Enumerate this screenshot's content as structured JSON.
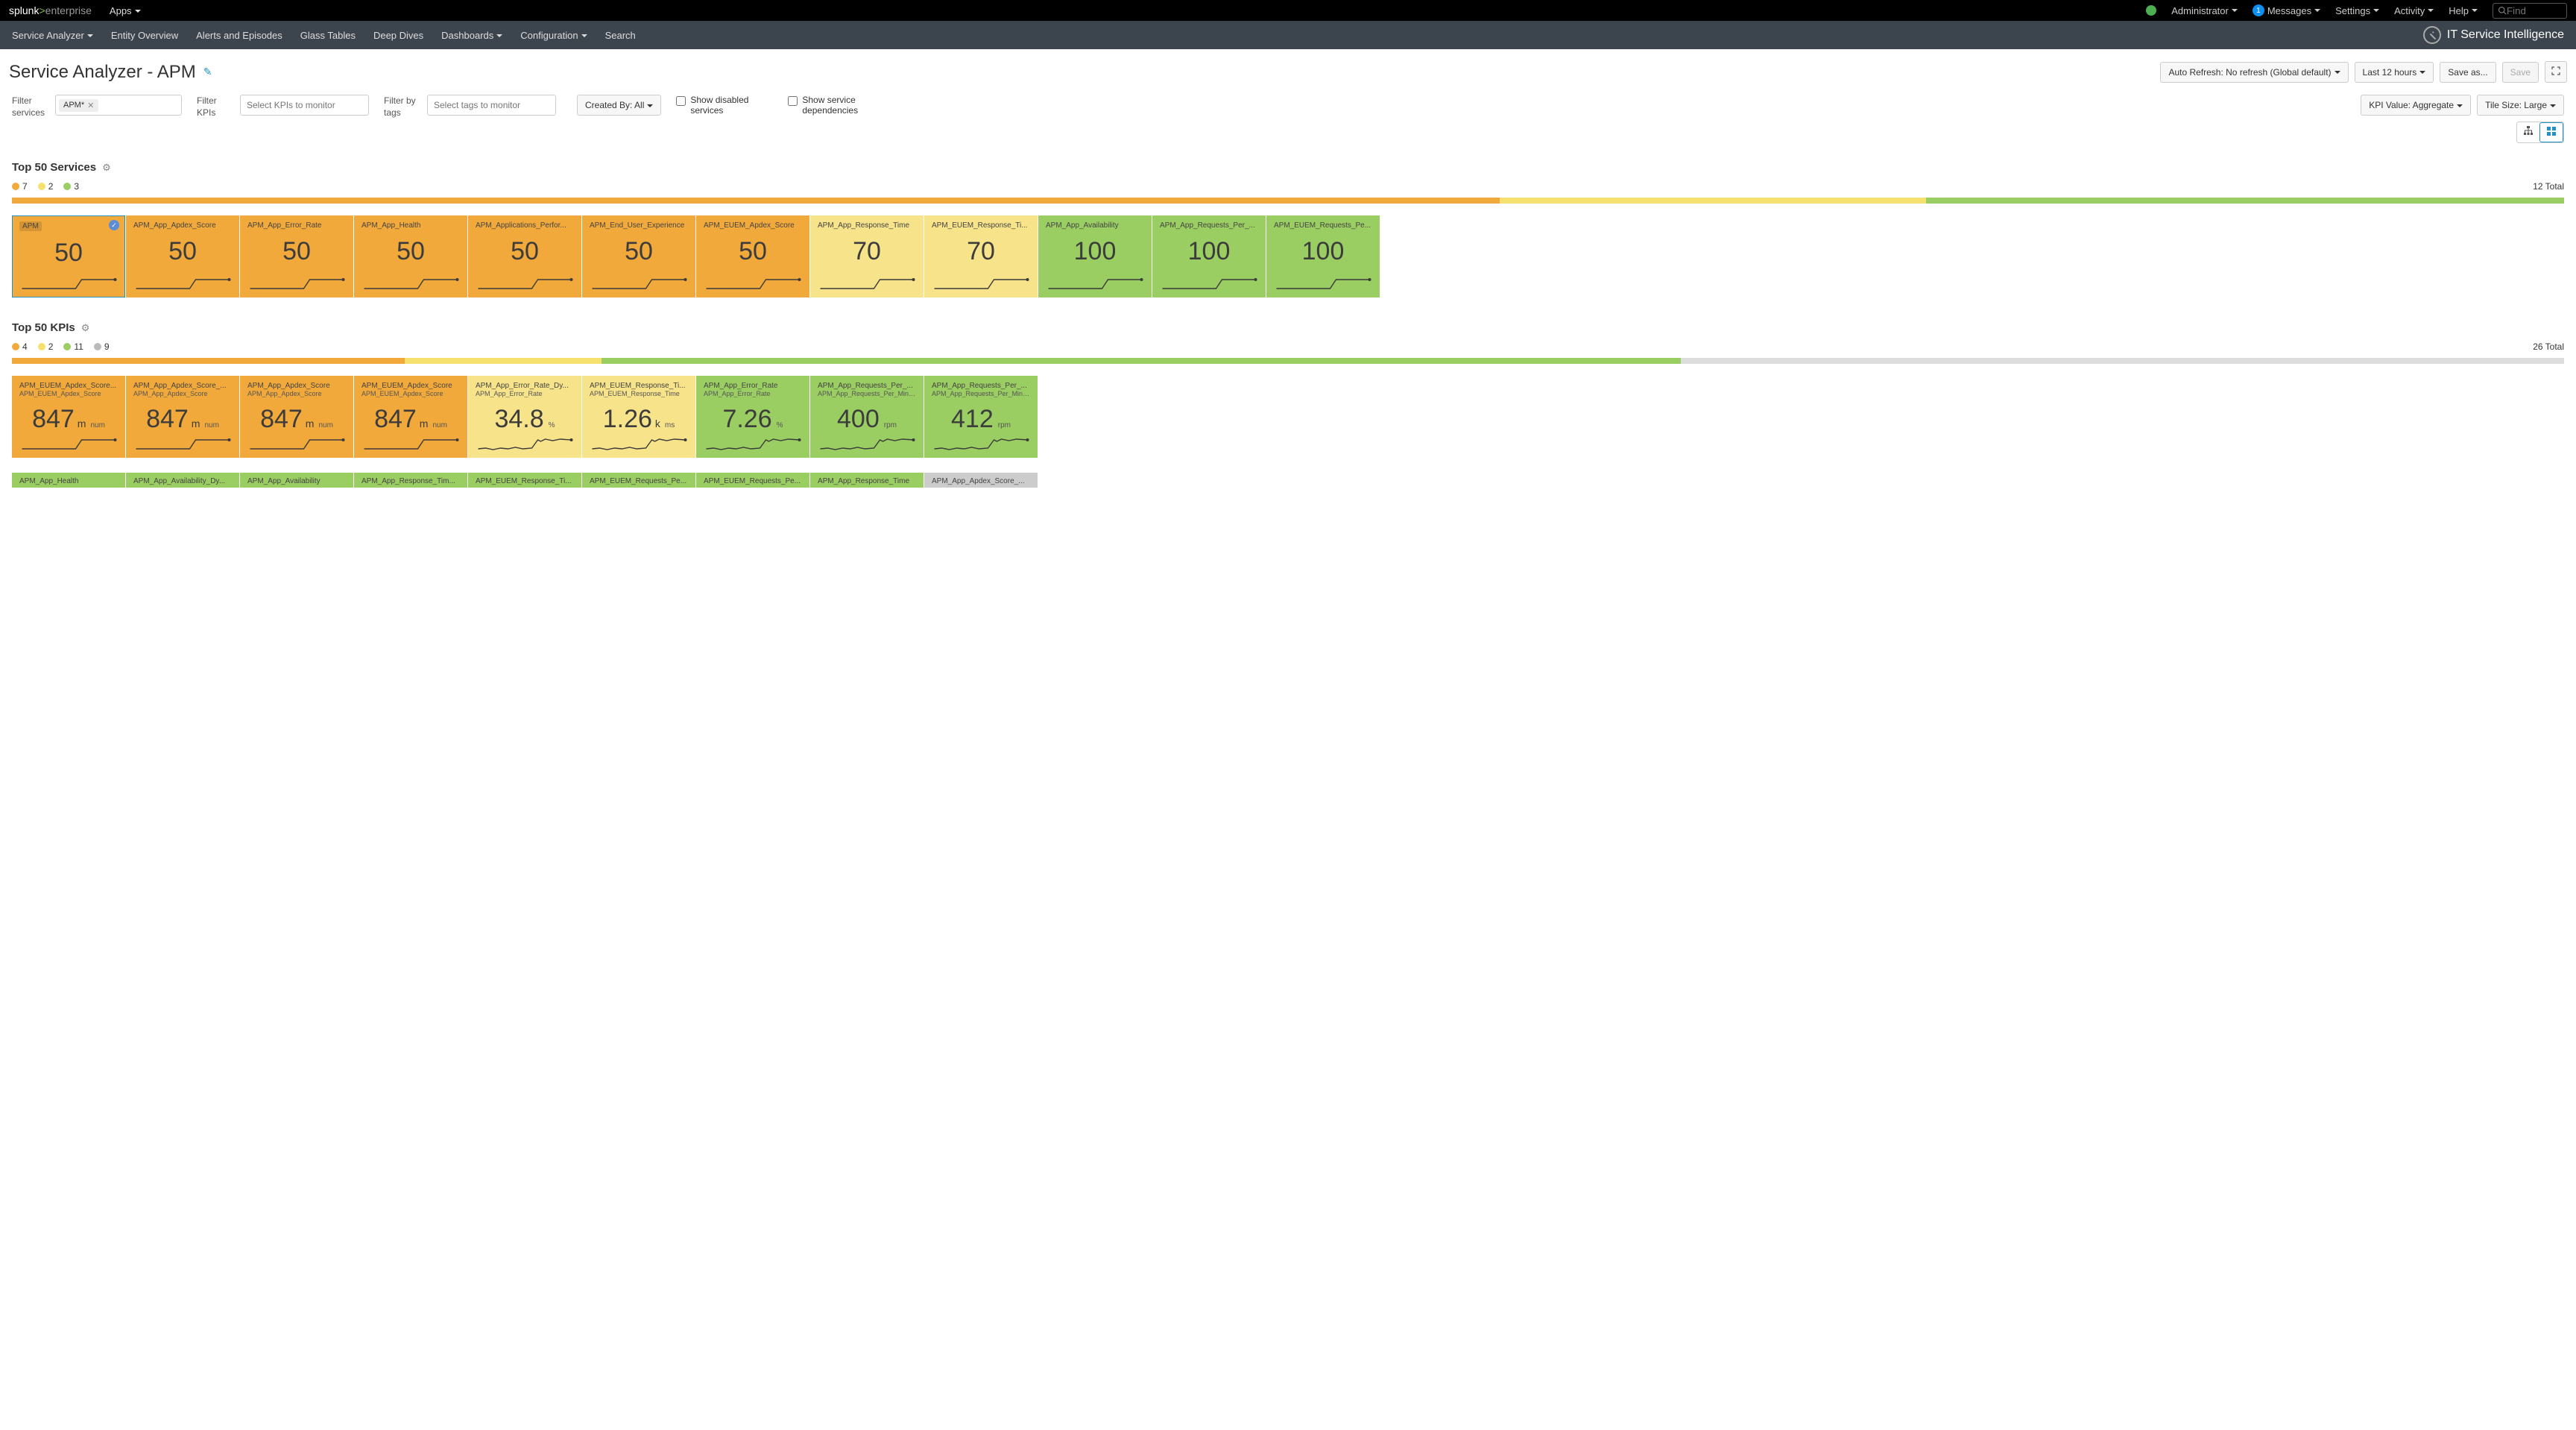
{
  "topbar": {
    "brand_splunk": "splunk",
    "brand_gt": ">",
    "brand_ent": "enterprise",
    "apps_label": "Apps",
    "admin_label": "Administrator",
    "messages_count": "1",
    "messages_label": "Messages",
    "settings_label": "Settings",
    "activity_label": "Activity",
    "help_label": "Help",
    "find_placeholder": "Find"
  },
  "navbar": {
    "items": [
      "Service Analyzer",
      "Entity Overview",
      "Alerts and Episodes",
      "Glass Tables",
      "Deep Dives",
      "Dashboards",
      "Configuration",
      "Search"
    ],
    "app_title": "IT Service Intelligence"
  },
  "page": {
    "title": "Service Analyzer - APM",
    "auto_refresh": "Auto Refresh: No refresh (Global default)",
    "time_range": "Last 12 hours",
    "save_as": "Save as...",
    "save": "Save"
  },
  "filters": {
    "services_label": "Filter services",
    "services_chip": "APM*",
    "kpis_label": "Filter KPIs",
    "kpis_placeholder": "Select KPIs to monitor",
    "tags_label": "Filter by tags",
    "tags_placeholder": "Select tags to monitor",
    "created_by": "Created By: All",
    "show_disabled": "Show disabled services",
    "show_dependencies": "Show service dependencies",
    "kpi_value": "KPI Value: Aggregate",
    "tile_size": "Tile Size: Large"
  },
  "services": {
    "title": "Top 50 Services",
    "legend_orange": "7",
    "legend_yellow": "2",
    "legend_green": "3",
    "total": "12 Total",
    "bar": {
      "orange": 58.3,
      "yellow": 16.7,
      "green": 25.0
    },
    "tiles": [
      {
        "name": "APM",
        "value": "50",
        "color": "orange",
        "selected": true,
        "chip": true
      },
      {
        "name": "APM_App_Apdex_Score",
        "value": "50",
        "color": "orange"
      },
      {
        "name": "APM_App_Error_Rate",
        "value": "50",
        "color": "orange"
      },
      {
        "name": "APM_App_Health",
        "value": "50",
        "color": "orange"
      },
      {
        "name": "APM_Applications_Perfor...",
        "value": "50",
        "color": "orange"
      },
      {
        "name": "APM_End_User_Experience",
        "value": "50",
        "color": "orange"
      },
      {
        "name": "APM_EUEM_Apdex_Score",
        "value": "50",
        "color": "orange"
      },
      {
        "name": "APM_App_Response_Time",
        "value": "70",
        "color": "yellow"
      },
      {
        "name": "APM_EUEM_Response_Ti...",
        "value": "70",
        "color": "yellow"
      },
      {
        "name": "APM_App_Availability",
        "value": "100",
        "color": "green"
      },
      {
        "name": "APM_App_Requests_Per_...",
        "value": "100",
        "color": "green"
      },
      {
        "name": "APM_EUEM_Requests_Pe...",
        "value": "100",
        "color": "green"
      }
    ]
  },
  "kpis": {
    "title": "Top 50 KPIs",
    "legend_orange": "4",
    "legend_yellow": "2",
    "legend_green": "11",
    "legend_grey": "9",
    "total": "26 Total",
    "bar": {
      "orange": 15.4,
      "yellow": 7.7,
      "green": 42.3,
      "grey": 34.6
    },
    "tiles_row1": [
      {
        "name": "APM_EUEM_Apdex_Score...",
        "sub": "APM_EUEM_Apdex_Score",
        "value": "847",
        "unit": "m",
        "label": "num",
        "color": "orange"
      },
      {
        "name": "APM_App_Apdex_Score_...",
        "sub": "APM_App_Apdex_Score",
        "value": "847",
        "unit": "m",
        "label": "num",
        "color": "orange"
      },
      {
        "name": "APM_App_Apdex_Score",
        "sub": "APM_App_Apdex_Score",
        "value": "847",
        "unit": "m",
        "label": "num",
        "color": "orange"
      },
      {
        "name": "APM_EUEM_Apdex_Score",
        "sub": "APM_EUEM_Apdex_Score",
        "value": "847",
        "unit": "m",
        "label": "num",
        "color": "orange"
      },
      {
        "name": "APM_App_Error_Rate_Dy...",
        "sub": "APM_App_Error_Rate",
        "value": "34.8",
        "unit": "",
        "label": "%",
        "color": "yellow"
      },
      {
        "name": "APM_EUEM_Response_Ti...",
        "sub": "APM_EUEM_Response_Time",
        "value": "1.26",
        "unit": "k",
        "label": "ms",
        "color": "yellow"
      },
      {
        "name": "APM_App_Error_Rate",
        "sub": "APM_App_Error_Rate",
        "value": "7.26",
        "unit": "",
        "label": "%",
        "color": "green"
      },
      {
        "name": "APM_App_Requests_Per_...",
        "sub": "APM_App_Requests_Per_Minute",
        "value": "400",
        "unit": "",
        "label": "rpm",
        "color": "green"
      },
      {
        "name": "APM_App_Requests_Per_...",
        "sub": "APM_App_Requests_Per_Minute",
        "value": "412",
        "unit": "",
        "label": "rpm",
        "color": "green"
      }
    ],
    "tiles_row2": [
      {
        "name": "APM_App_Health",
        "color": "green"
      },
      {
        "name": "APM_App_Availability_Dy...",
        "color": "green"
      },
      {
        "name": "APM_App_Availability",
        "color": "green"
      },
      {
        "name": "APM_App_Response_Tim...",
        "color": "green"
      },
      {
        "name": "APM_EUEM_Response_Ti...",
        "color": "green"
      },
      {
        "name": "APM_EUEM_Requests_Pe...",
        "color": "green"
      },
      {
        "name": "APM_EUEM_Requests_Pe...",
        "color": "green"
      },
      {
        "name": "APM_App_Response_Time",
        "color": "green"
      },
      {
        "name": "APM_App_Apdex_Score_...",
        "color": "grey"
      }
    ]
  }
}
